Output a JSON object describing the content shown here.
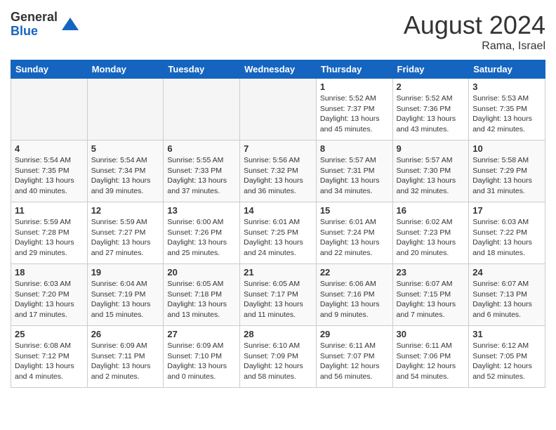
{
  "logo": {
    "general": "General",
    "blue": "Blue"
  },
  "title": {
    "month_year": "August 2024",
    "location": "Rama, Israel"
  },
  "weekdays": [
    "Sunday",
    "Monday",
    "Tuesday",
    "Wednesday",
    "Thursday",
    "Friday",
    "Saturday"
  ],
  "weeks": [
    [
      {
        "day": "",
        "info": ""
      },
      {
        "day": "",
        "info": ""
      },
      {
        "day": "",
        "info": ""
      },
      {
        "day": "",
        "info": ""
      },
      {
        "day": "1",
        "info": "Sunrise: 5:52 AM\nSunset: 7:37 PM\nDaylight: 13 hours\nand 45 minutes."
      },
      {
        "day": "2",
        "info": "Sunrise: 5:52 AM\nSunset: 7:36 PM\nDaylight: 13 hours\nand 43 minutes."
      },
      {
        "day": "3",
        "info": "Sunrise: 5:53 AM\nSunset: 7:35 PM\nDaylight: 13 hours\nand 42 minutes."
      }
    ],
    [
      {
        "day": "4",
        "info": "Sunrise: 5:54 AM\nSunset: 7:35 PM\nDaylight: 13 hours\nand 40 minutes."
      },
      {
        "day": "5",
        "info": "Sunrise: 5:54 AM\nSunset: 7:34 PM\nDaylight: 13 hours\nand 39 minutes."
      },
      {
        "day": "6",
        "info": "Sunrise: 5:55 AM\nSunset: 7:33 PM\nDaylight: 13 hours\nand 37 minutes."
      },
      {
        "day": "7",
        "info": "Sunrise: 5:56 AM\nSunset: 7:32 PM\nDaylight: 13 hours\nand 36 minutes."
      },
      {
        "day": "8",
        "info": "Sunrise: 5:57 AM\nSunset: 7:31 PM\nDaylight: 13 hours\nand 34 minutes."
      },
      {
        "day": "9",
        "info": "Sunrise: 5:57 AM\nSunset: 7:30 PM\nDaylight: 13 hours\nand 32 minutes."
      },
      {
        "day": "10",
        "info": "Sunrise: 5:58 AM\nSunset: 7:29 PM\nDaylight: 13 hours\nand 31 minutes."
      }
    ],
    [
      {
        "day": "11",
        "info": "Sunrise: 5:59 AM\nSunset: 7:28 PM\nDaylight: 13 hours\nand 29 minutes."
      },
      {
        "day": "12",
        "info": "Sunrise: 5:59 AM\nSunset: 7:27 PM\nDaylight: 13 hours\nand 27 minutes."
      },
      {
        "day": "13",
        "info": "Sunrise: 6:00 AM\nSunset: 7:26 PM\nDaylight: 13 hours\nand 25 minutes."
      },
      {
        "day": "14",
        "info": "Sunrise: 6:01 AM\nSunset: 7:25 PM\nDaylight: 13 hours\nand 24 minutes."
      },
      {
        "day": "15",
        "info": "Sunrise: 6:01 AM\nSunset: 7:24 PM\nDaylight: 13 hours\nand 22 minutes."
      },
      {
        "day": "16",
        "info": "Sunrise: 6:02 AM\nSunset: 7:23 PM\nDaylight: 13 hours\nand 20 minutes."
      },
      {
        "day": "17",
        "info": "Sunrise: 6:03 AM\nSunset: 7:22 PM\nDaylight: 13 hours\nand 18 minutes."
      }
    ],
    [
      {
        "day": "18",
        "info": "Sunrise: 6:03 AM\nSunset: 7:20 PM\nDaylight: 13 hours\nand 17 minutes."
      },
      {
        "day": "19",
        "info": "Sunrise: 6:04 AM\nSunset: 7:19 PM\nDaylight: 13 hours\nand 15 minutes."
      },
      {
        "day": "20",
        "info": "Sunrise: 6:05 AM\nSunset: 7:18 PM\nDaylight: 13 hours\nand 13 minutes."
      },
      {
        "day": "21",
        "info": "Sunrise: 6:05 AM\nSunset: 7:17 PM\nDaylight: 13 hours\nand 11 minutes."
      },
      {
        "day": "22",
        "info": "Sunrise: 6:06 AM\nSunset: 7:16 PM\nDaylight: 13 hours\nand 9 minutes."
      },
      {
        "day": "23",
        "info": "Sunrise: 6:07 AM\nSunset: 7:15 PM\nDaylight: 13 hours\nand 7 minutes."
      },
      {
        "day": "24",
        "info": "Sunrise: 6:07 AM\nSunset: 7:13 PM\nDaylight: 13 hours\nand 6 minutes."
      }
    ],
    [
      {
        "day": "25",
        "info": "Sunrise: 6:08 AM\nSunset: 7:12 PM\nDaylight: 13 hours\nand 4 minutes."
      },
      {
        "day": "26",
        "info": "Sunrise: 6:09 AM\nSunset: 7:11 PM\nDaylight: 13 hours\nand 2 minutes."
      },
      {
        "day": "27",
        "info": "Sunrise: 6:09 AM\nSunset: 7:10 PM\nDaylight: 13 hours\nand 0 minutes."
      },
      {
        "day": "28",
        "info": "Sunrise: 6:10 AM\nSunset: 7:09 PM\nDaylight: 12 hours\nand 58 minutes."
      },
      {
        "day": "29",
        "info": "Sunrise: 6:11 AM\nSunset: 7:07 PM\nDaylight: 12 hours\nand 56 minutes."
      },
      {
        "day": "30",
        "info": "Sunrise: 6:11 AM\nSunset: 7:06 PM\nDaylight: 12 hours\nand 54 minutes."
      },
      {
        "day": "31",
        "info": "Sunrise: 6:12 AM\nSunset: 7:05 PM\nDaylight: 12 hours\nand 52 minutes."
      }
    ]
  ]
}
